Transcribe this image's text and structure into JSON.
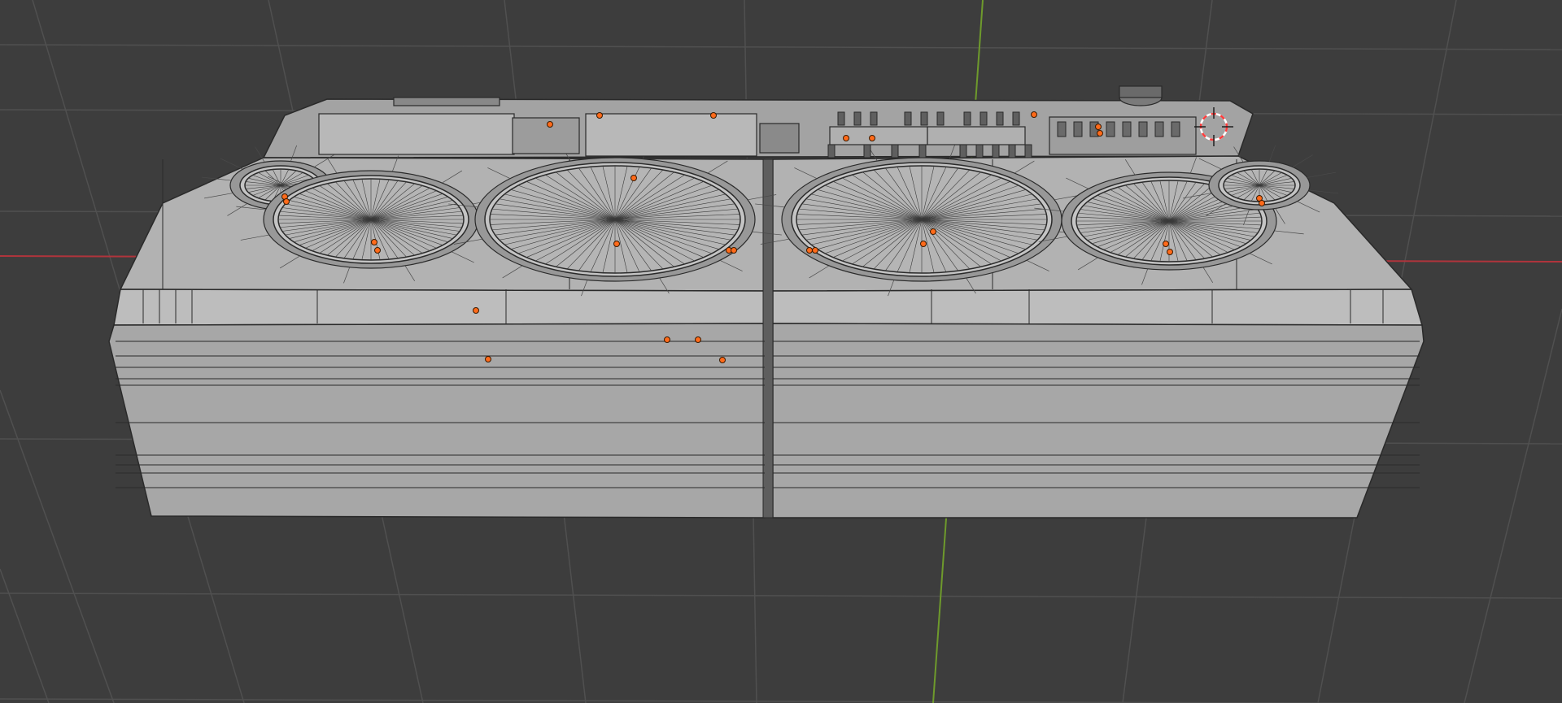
{
  "viewport": {
    "background_color": "#3d3d3d",
    "grid_color": "#505050",
    "x_axis_color": "#b0343c",
    "y_axis_color": "#6e9a2c",
    "mesh_color": "#a9a9a9",
    "mesh_dark_color": "#8f8f8f",
    "wire_color": "#2a2a2a",
    "selection_color": "#ff6a1a",
    "cursor_color": "#ff3b3b",
    "icons": [
      "3d-cursor-icon"
    ]
  },
  "model": {
    "name": "boombox",
    "halves": [
      "left-half",
      "right-half"
    ],
    "speakers": [
      "left-tweeter",
      "left-woofer-small",
      "left-woofer-large",
      "right-woofer-large",
      "right-woofer-small",
      "right-tweeter"
    ]
  }
}
